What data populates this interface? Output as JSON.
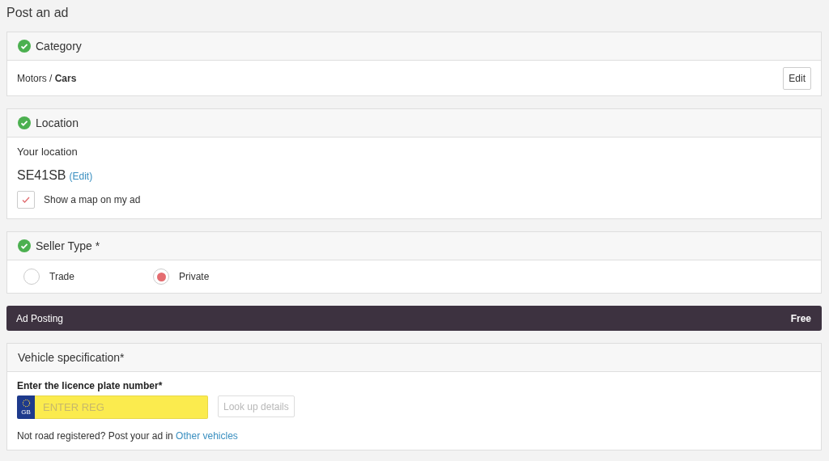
{
  "page_title": "Post an ad",
  "category": {
    "title": "Category",
    "completed": true,
    "path": "Motors / **Cars**",
    "edit_button": "Edit"
  },
  "location": {
    "title": "Location",
    "completed": true,
    "label": "Your location",
    "postcode": "SE41SB",
    "edit_link": "(Edit)",
    "show_map": {
      "label": "Show a map on my ad",
      "checked": true
    }
  },
  "seller_type": {
    "title": "Seller Type *",
    "completed": true,
    "options": [
      {
        "label": "Trade",
        "selected": false
      },
      {
        "label": "Private",
        "selected": true
      }
    ]
  },
  "ad_posting": {
    "label": "Ad Posting",
    "price": "Free"
  },
  "vehicle": {
    "title": "Vehicle specification*",
    "plate_label": "Enter the licence plate number*",
    "country": "GB",
    "placeholder": "ENTER REG",
    "lookup_button": "Look up details",
    "lookup_disabled": true,
    "note": "Not road registered? Post your ad in",
    "note_link": "Other vehicles"
  }
}
